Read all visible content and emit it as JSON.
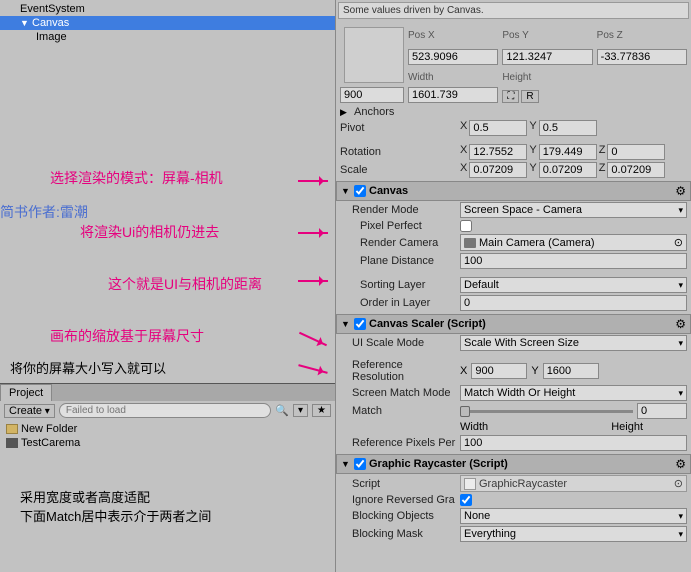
{
  "hierarchy": {
    "items": [
      {
        "label": "EventSystem"
      },
      {
        "label": "Canvas"
      },
      {
        "label": "Image"
      }
    ]
  },
  "annotations": {
    "a1": "选择渲染的模式：屏幕-相机",
    "a2": "简书作者:雷潮",
    "a3": "将渲染Ui的相机仍进去",
    "a4": "这个就是UI与相机的距离",
    "a5": "画布的缩放基于屏幕尺寸",
    "a6": "将你的屏幕大小写入就可以",
    "a7": "采用宽度或者高度适配",
    "a8": "下面Match居中表示介于两者之间"
  },
  "project": {
    "tab": "Project",
    "create": "Create",
    "failed": "Failed to load",
    "items": [
      {
        "label": "New Folder",
        "type": "folder"
      },
      {
        "label": "TestCarema",
        "type": "scene"
      }
    ]
  },
  "inspector": {
    "banner": "Some values driven by Canvas.",
    "posx_label": "Pos X",
    "posy_label": "Pos Y",
    "posz_label": "Pos Z",
    "posx": "523.9096",
    "posy": "121.3247",
    "posz": "-33.77836",
    "width_label": "Width",
    "height_label": "Height",
    "width": "900",
    "height": "1601.739",
    "gizmo_btn1": "⛶",
    "gizmo_btn2": "R",
    "anchors": "Anchors",
    "pivot": "Pivot",
    "pivot_x": "0.5",
    "pivot_y": "0.5",
    "rotation": "Rotation",
    "rot_x": "12.7552",
    "rot_y": "179.449",
    "rot_z": "0",
    "scale": "Scale",
    "scale_x": "0.07209",
    "scale_y": "0.07209",
    "scale_z": "0.07209",
    "x": "X",
    "y": "Y",
    "z": "Z",
    "canvas": {
      "title": "Canvas",
      "render_mode": "Render Mode",
      "render_mode_val": "Screen Space - Camera",
      "pixel_perfect": "Pixel Perfect",
      "render_camera": "Render Camera",
      "render_camera_val": "Main Camera (Camera)",
      "plane_distance": "Plane Distance",
      "plane_distance_val": "100",
      "sorting_layer": "Sorting Layer",
      "sorting_layer_val": "Default",
      "order_in_layer": "Order in Layer",
      "order_in_layer_val": "0"
    },
    "scaler": {
      "title": "Canvas Scaler (Script)",
      "ui_scale_mode": "UI Scale Mode",
      "ui_scale_mode_val": "Scale With Screen Size",
      "reference_resolution": "Reference Resolution",
      "ref_x": "900",
      "ref_y": "1600",
      "screen_match_mode": "Screen Match Mode",
      "screen_match_mode_val": "Match Width Or Height",
      "match": "Match",
      "match_val": "0",
      "match_left": "Width",
      "match_right": "Height",
      "reference_pixels": "Reference Pixels Per",
      "reference_pixels_val": "100"
    },
    "raycaster": {
      "title": "Graphic Raycaster (Script)",
      "script": "Script",
      "script_val": "GraphicRaycaster",
      "ignore_reversed": "Ignore Reversed Gra",
      "blocking_objects": "Blocking Objects",
      "blocking_objects_val": "None",
      "blocking_mask": "Blocking Mask",
      "blocking_mask_val": "Everything"
    }
  }
}
